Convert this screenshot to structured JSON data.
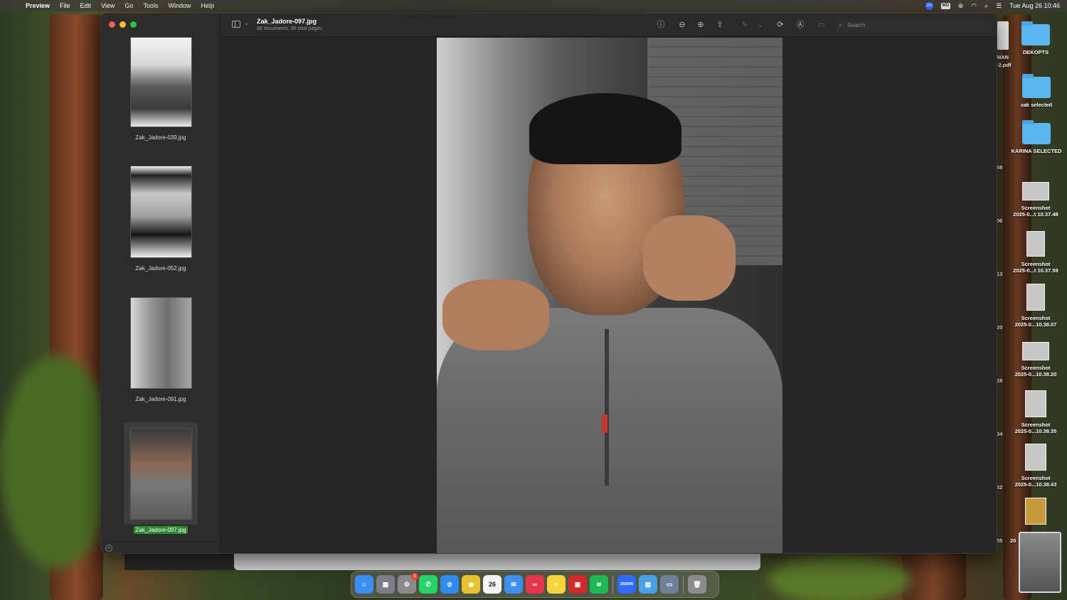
{
  "menubar": {
    "app_name": "Preview",
    "menus": [
      "File",
      "Edit",
      "View",
      "Go",
      "Tools",
      "Window",
      "Help"
    ],
    "status_items": [
      "zoom-icon",
      "wd-icon",
      "creative-cloud-icon",
      "wifi-icon",
      "spotlight-icon",
      "control-center-icon"
    ],
    "wd_label": "WD",
    "datetime": "Tue Aug 26  10:46"
  },
  "window": {
    "title": "Zak_Jadore-097.jpg",
    "subtitle": "86 documents, 86 total pages",
    "search_placeholder": "Search",
    "toolbar_icons": [
      "info-icon",
      "zoom-out-icon",
      "zoom-in-icon",
      "share-icon",
      "highlight-icon",
      "rotate-icon",
      "markup-icon",
      "form-icon"
    ]
  },
  "sidebar": {
    "thumbnails": [
      {
        "label": "Zak_Jadore-039.jpg"
      },
      {
        "label": "Zak_Jadore-052.jpg"
      },
      {
        "label": "Zak_Jadore-091.jpg"
      },
      {
        "label": "Zak_Jadore-097.jpg",
        "selected": true
      }
    ]
  },
  "desktop": {
    "folders": [
      "DEKOPTS",
      "zak selected",
      "KARINA SELECTED"
    ],
    "screenshots": [
      {
        "line1": "Screenshot",
        "line2": "2025-0...t 10.37.48"
      },
      {
        "line1": "Screenshot",
        "line2": "2025-0...t 10.37.59"
      },
      {
        "line1": "Screenshot",
        "line2": "2025-0...10.38.07"
      },
      {
        "line1": "Screenshot",
        "line2": "2025-0...10.38.20"
      },
      {
        "line1": "Screenshot",
        "line2": "2025-0...10.38.35"
      },
      {
        "line1": "Screenshot",
        "line2": "2025-0...10.38.43"
      }
    ],
    "edge_labels": [
      "MAN",
      "-2.pdf",
      "58",
      "06",
      "13",
      "20",
      "28",
      "34",
      "32",
      "55",
      "20"
    ]
  },
  "dock": {
    "apps": [
      {
        "name": "finder-icon",
        "color": "#3a8ef6",
        "glyph": "☺"
      },
      {
        "name": "launchpad-icon",
        "color": "#7c7c8a",
        "glyph": "▦"
      },
      {
        "name": "system-settings-icon",
        "color": "#8a8a8a",
        "glyph": "⚙",
        "badge": "1"
      },
      {
        "name": "whatsapp-icon",
        "color": "#25d366",
        "glyph": "✆"
      },
      {
        "name": "safari-icon",
        "color": "#2f8bf0",
        "glyph": "⊘"
      },
      {
        "name": "chrome-icon",
        "color": "#e8c32f",
        "glyph": "◉"
      },
      {
        "name": "calendar-icon",
        "color": "#f4f4f4",
        "glyph": "26",
        "dark_text": true
      },
      {
        "name": "mail-icon",
        "color": "#3d8ff0",
        "glyph": "✉"
      },
      {
        "name": "creative-cloud-icon",
        "color": "#e8344c",
        "glyph": "∞"
      },
      {
        "name": "notes-icon",
        "color": "#f6d33b",
        "glyph": "≡"
      },
      {
        "name": "photo-booth-icon",
        "color": "#d02a2a",
        "glyph": "▣"
      },
      {
        "name": "spotify-icon",
        "color": "#1db954",
        "glyph": "≋"
      },
      {
        "name": "zoom-icon",
        "color": "#2d6cff",
        "glyph": "zoom"
      },
      {
        "name": "preview-icon",
        "color": "#4aa0e8",
        "glyph": "▤"
      },
      {
        "name": "screen-sharing-icon",
        "color": "#6e7f98",
        "glyph": "▭"
      },
      {
        "name": "trash-icon",
        "color": "#8c8c8c",
        "glyph": "🗑"
      }
    ]
  }
}
